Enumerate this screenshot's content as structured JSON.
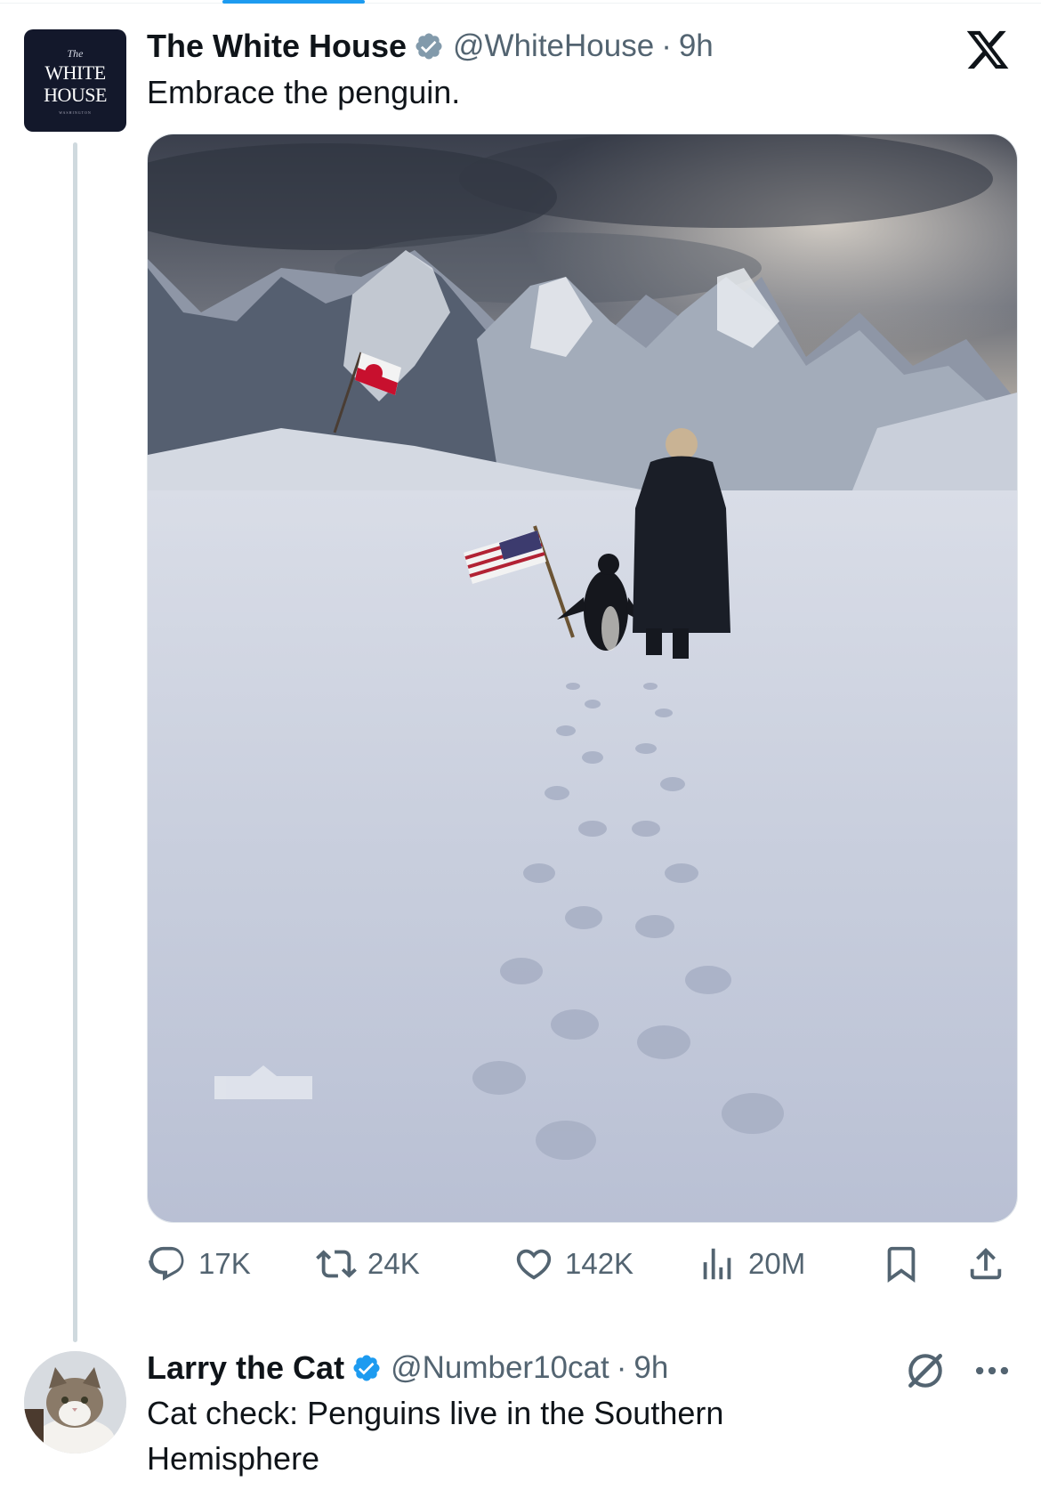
{
  "tweet": {
    "author_name": "The White House",
    "author_handle": "@WhiteHouse",
    "separator": "·",
    "time": "9h",
    "text": "Embrace the penguin.",
    "avatar": {
      "line_the": "The",
      "line1": "WHITE",
      "line2": "HOUSE",
      "line_small": "WASHINGTON"
    },
    "image_icon": "arctic-penguin-photo",
    "stats": {
      "replies": "17K",
      "reposts": "24K",
      "likes": "142K",
      "views": "20M"
    },
    "icons": [
      "x-logo-icon",
      "reply-icon",
      "repost-icon",
      "like-icon",
      "views-icon",
      "bookmark-icon",
      "share-icon",
      "verified-badge-icon"
    ]
  },
  "reply": {
    "author_name": "Larry the Cat",
    "author_handle": "@Number10cat",
    "separator": "·",
    "time": "9h",
    "text": "Cat check: Penguins live in the Southern Hemisphere",
    "icons": [
      "verified-badge-icon",
      "grok-icon",
      "more-options-icon"
    ]
  },
  "colors": {
    "accent": "#1d9bf0",
    "secondary_text": "#536471",
    "thread_line": "#cfd9de"
  }
}
